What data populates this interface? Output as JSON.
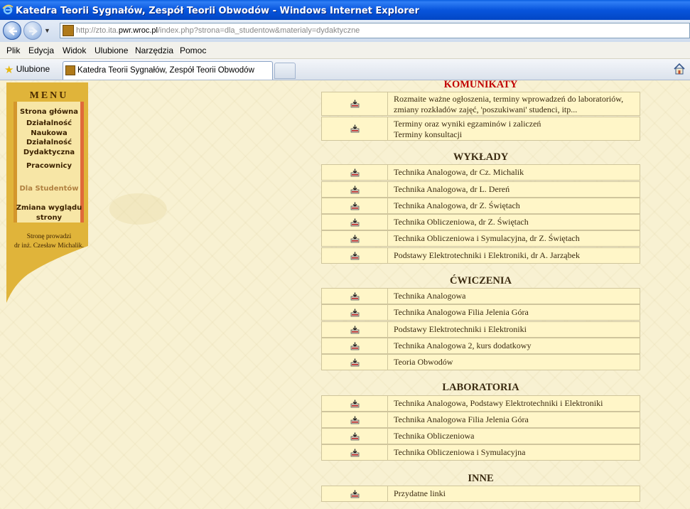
{
  "window": {
    "title": "Katedra Teorii Sygnałów, Zespół Teorii Obwodów - Windows Internet Explorer"
  },
  "address": {
    "url_prefix": "http://zto.ita.",
    "url_domain": "pwr.wroc.pl",
    "url_suffix": "/index.php?strona=dla_studentow&materialy=dydaktyczne"
  },
  "menubar": [
    "Plik",
    "Edycja",
    "Widok",
    "Ulubione",
    "Narzędzia",
    "Pomoc"
  ],
  "tabbar": {
    "favorites": "Ulubione",
    "tab_title": "Katedra Teorii Sygnałów, Zespół Teorii Obwodów"
  },
  "sidebar": {
    "title": "MENU",
    "items": [
      {
        "label": "Strona główna"
      },
      {
        "label": "Działalność\nNaukowa"
      },
      {
        "label": "Działalność\nDydaktyczna"
      },
      {
        "label": "Pracownicy"
      },
      {
        "label": "Dla Studentów"
      },
      {
        "label": "Zmiana wyglądu\nstrony"
      }
    ],
    "credit_line1": "Stronę prowadzi",
    "credit_line2": "dr inż. Czesław Michalik."
  },
  "sections": {
    "komunikaty": {
      "title": "KOMUNIKATY",
      "rows": [
        "Rozmaite ważne ogłoszenia, terminy wprowadzeń do laboratoriów, zmiany rozkładów zajęć, 'poszukiwani' studenci, itp...",
        "Terminy oraz wyniki egzaminów i zaliczeń\nTerminy konsultacji"
      ]
    },
    "wyklady": {
      "title": "WYKŁADY",
      "rows": [
        "Technika Analogowa, dr Cz. Michalik",
        "Technika Analogowa, dr L. Dereń",
        "Technika Analogowa, dr Z. Świętach",
        "Technika Obliczeniowa, dr Z. Świętach",
        "Technika Obliczeniowa i Symulacyjna, dr Z. Świętach",
        "Podstawy Elektrotechniki i Elektroniki, dr A. Jarząbek"
      ]
    },
    "cwiczenia": {
      "title": "ĆWICZENIA",
      "rows": [
        "Technika Analogowa",
        "Technika Analogowa Filia Jelenia Góra",
        "Podstawy Elektrotechniki i Elektroniki",
        "Technika Analogowa 2, kurs dodatkowy",
        "Teoria Obwodów"
      ]
    },
    "laboratoria": {
      "title": "LABORATORIA",
      "rows": [
        "Technika Analogowa, Podstawy Elektrotechniki i Elektroniki",
        "Technika Analogowa Filia Jelenia Góra",
        "Technika Obliczeniowa",
        "Technika Obliczeniowa i Symulacyjna"
      ]
    },
    "inne": {
      "title": "INNE",
      "rows": [
        "Przydatne linki"
      ]
    }
  },
  "colors": {
    "title_red": "#c00000",
    "row_bg": "#fff6c8",
    "sidebar_gold": "#e0b43a"
  }
}
